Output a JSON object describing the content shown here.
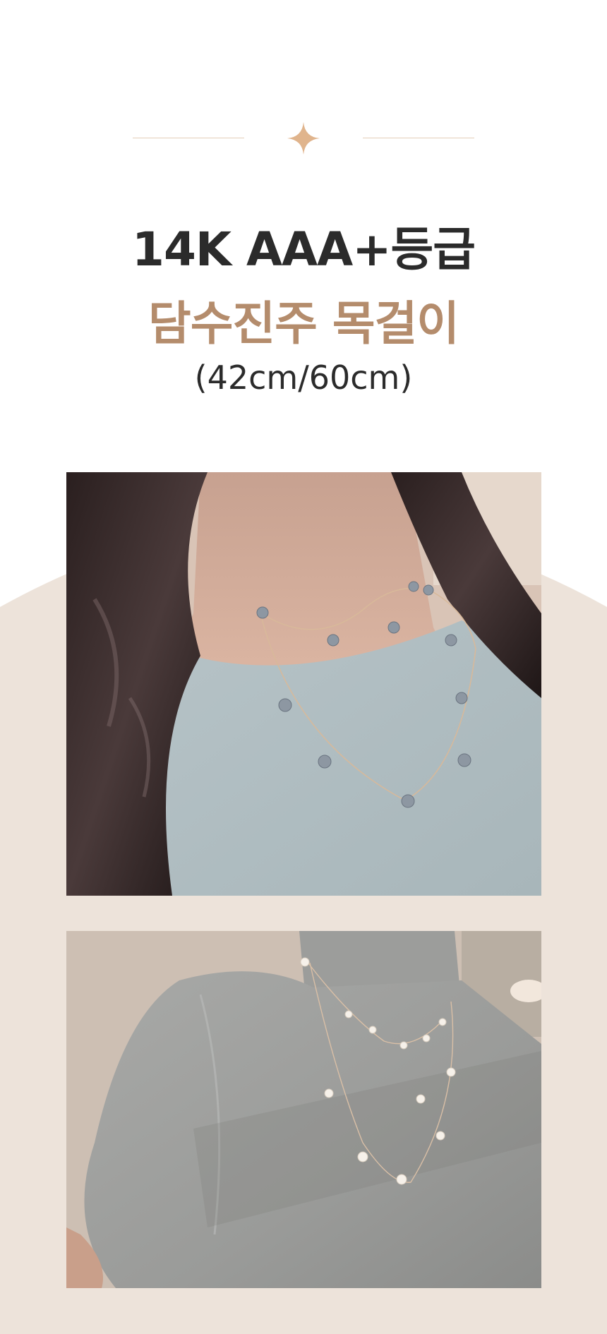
{
  "header": {
    "divider_icon": "sparkle-icon",
    "accent_color": "#b48c6c",
    "line_color": "#e3cdb8"
  },
  "product": {
    "title_line1": "14K AAA+등급",
    "title_line2": "담수진주 목걸이",
    "size_text": "(42cm/60cm)"
  },
  "gallery": {
    "background_color": "#ede3da",
    "photos": [
      {
        "name": "model-wearing-gray-pearl-necklace"
      },
      {
        "name": "model-wearing-white-pearl-long-necklace"
      }
    ]
  }
}
